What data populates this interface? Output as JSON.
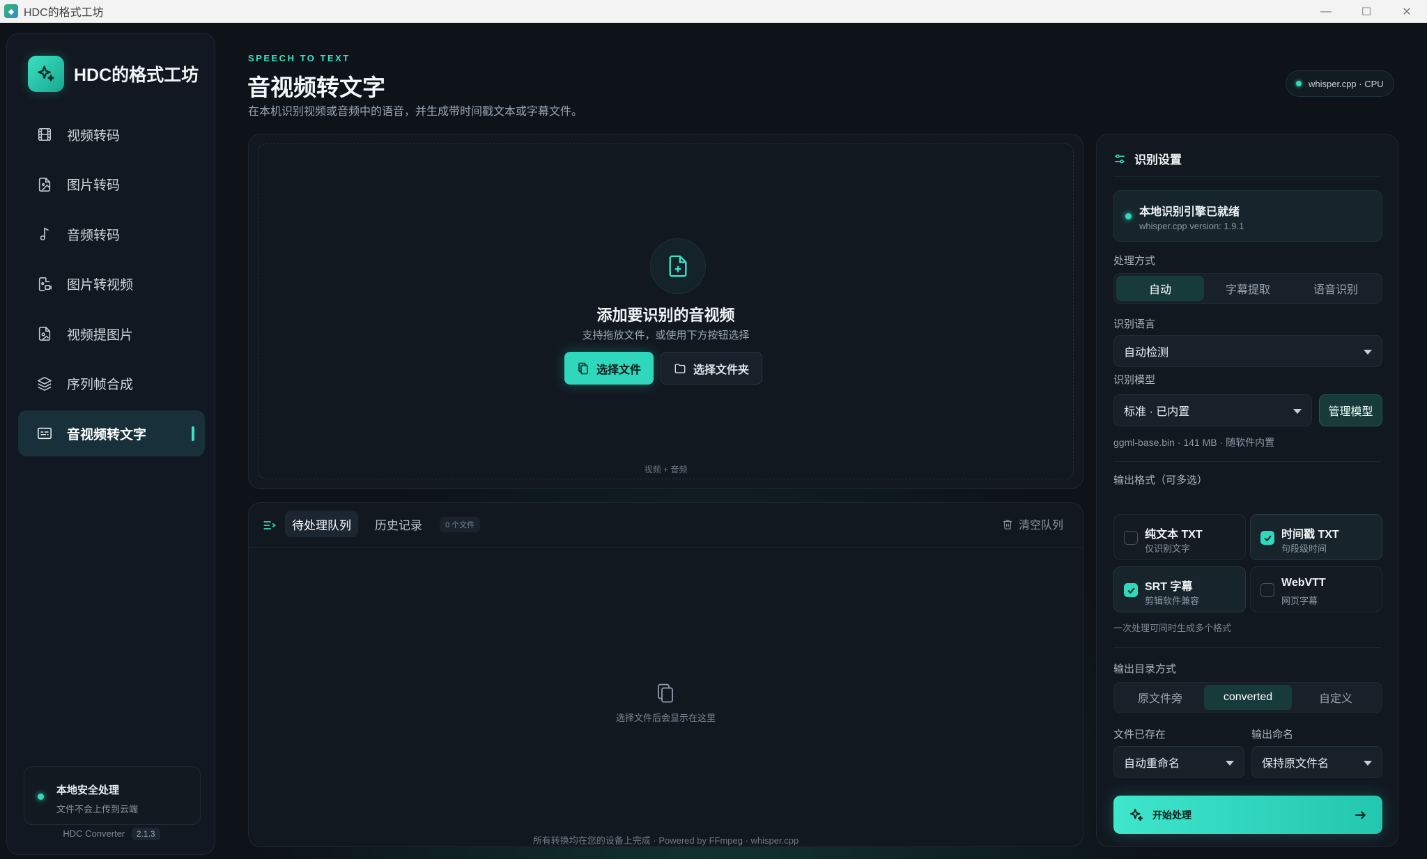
{
  "window": {
    "title": "HDC的格式工坊",
    "minimize": "—",
    "maximize": "☐",
    "close": "✕"
  },
  "sidebar": {
    "brand": "HDC的格式工坊",
    "items": [
      {
        "label": "视频转码",
        "icon": "film-icon"
      },
      {
        "label": "图片转码",
        "icon": "image-file-icon"
      },
      {
        "label": "音频转码",
        "icon": "music-note-icon"
      },
      {
        "label": "图片转视频",
        "icon": "image-to-video-icon"
      },
      {
        "label": "视频提图片",
        "icon": "video-to-image-icon"
      },
      {
        "label": "序列帧合成",
        "icon": "layers-icon"
      },
      {
        "label": "音视频转文字",
        "icon": "subtitles-icon",
        "active": true
      }
    ],
    "secure_title": "本地安全处理",
    "secure_desc": "文件不会上传到云端",
    "app_name": "HDC Converter",
    "version": "2.1.3"
  },
  "header": {
    "eyebrow": "SPEECH TO TEXT",
    "title": "音视频转文字",
    "description": "在本机识别视频或音频中的语音，并生成带时间戳文本或字幕文件。",
    "engine_pill": "whisper.cpp · CPU"
  },
  "dropzone": {
    "title": "添加要识别的音视频",
    "subtitle": "支持拖放文件，或使用下方按钮选择",
    "choose_file": "选择文件",
    "choose_folder": "选择文件夹",
    "footer": "视频 + 音频"
  },
  "queue": {
    "tab_pending": "待处理队列",
    "tab_history": "历史记录",
    "count": "0 个文件",
    "clear": "清空队列",
    "empty": "选择文件后会显示在这里"
  },
  "footer": "所有转换均在您的设备上完成 · Powered by FFmpeg · whisper.cpp",
  "settings": {
    "title": "识别设置",
    "engine_ready": "本地识别引擎已就绪",
    "engine_version": "whisper.cpp version: 1.9.1",
    "mode_label": "处理方式",
    "modes": [
      "自动",
      "字幕提取",
      "语音识别"
    ],
    "mode_selected": "自动",
    "language_label": "识别语言",
    "language_value": "自动检测",
    "model_label": "识别模型",
    "model_value": "标准 · 已内置",
    "manage_model": "管理模型",
    "model_info": "ggml-base.bin · 141 MB · 随软件内置",
    "format_label": "输出格式（可多选）",
    "formats": [
      {
        "name": "纯文本 TXT",
        "desc": "仅识别文字",
        "checked": false
      },
      {
        "name": "时间戳 TXT",
        "desc": "句段级时间",
        "checked": true
      },
      {
        "name": "SRT 字幕",
        "desc": "剪辑软件兼容",
        "checked": true
      },
      {
        "name": "WebVTT",
        "desc": "网页字幕",
        "checked": false
      }
    ],
    "format_note": "一次处理可同时生成多个格式",
    "outdir_label": "输出目录方式",
    "outdir_options": [
      "原文件旁",
      "converted",
      "自定义"
    ],
    "outdir_selected": "converted",
    "exists_label": "文件已存在",
    "exists_value": "自动重命名",
    "naming_label": "输出命名",
    "naming_value": "保持原文件名",
    "start": "开始处理"
  },
  "colors": {
    "accent": "#2fd7bd",
    "background": "#0e1319",
    "panel": "#121820"
  }
}
